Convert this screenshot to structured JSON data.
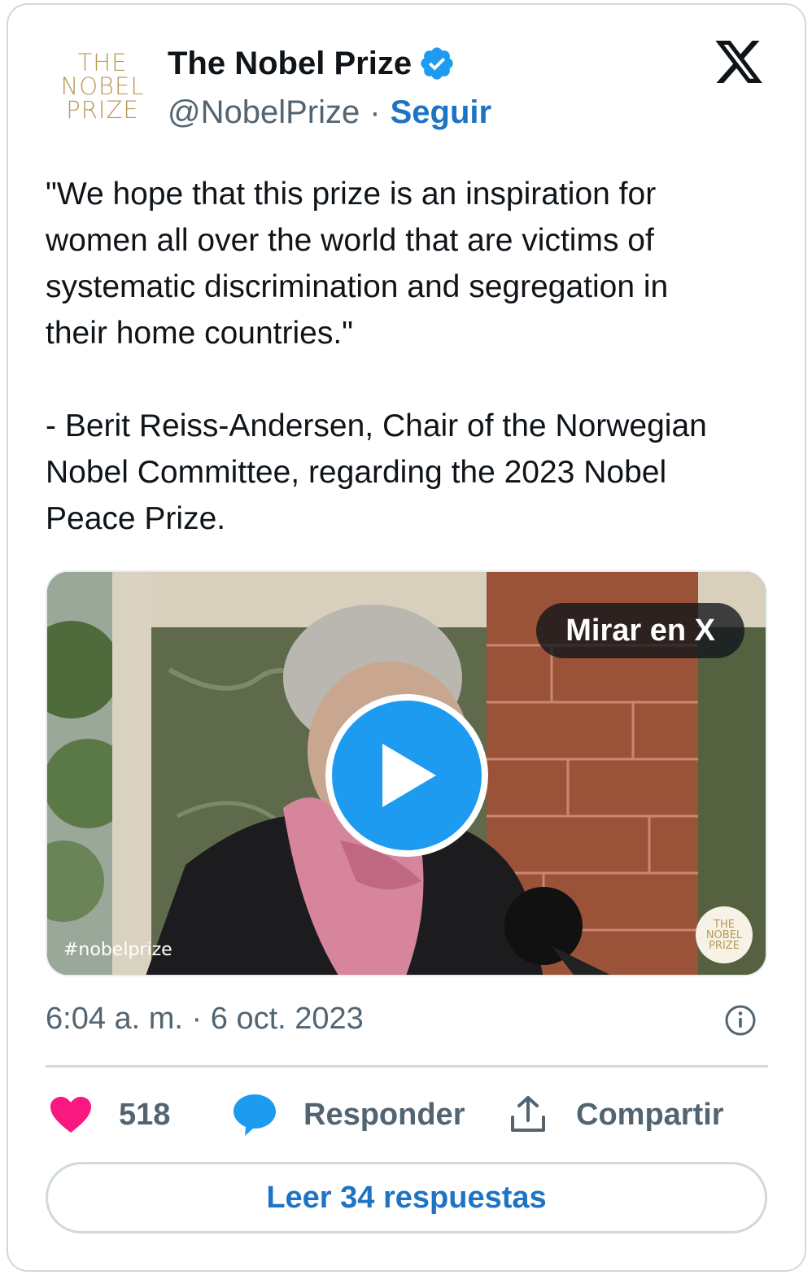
{
  "author": {
    "avatar_lines": [
      "THE",
      "NOBEL",
      "PRIZE"
    ],
    "name": "The Nobel Prize",
    "handle": "@NobelPrize",
    "separator": "·",
    "follow_label": "Seguir"
  },
  "tweet": {
    "text": "\"We hope that this prize is an inspiration for\nwomen all over the world that are victims of\nsystematic discrimination and segregation in\ntheir home countries.\"\n\n- Berit Reiss-Andersen, Chair of the Norwegian\nNobel Committee, regarding the 2023 Nobel\nPeace Prize."
  },
  "media": {
    "watch_label": "Mirar en X",
    "hashtag": "#nobelprize",
    "logo_lines": [
      "THE",
      "NOBEL",
      "PRIZE"
    ]
  },
  "meta": {
    "timestamp": "6:04 a. m. · 6 oct. 2023"
  },
  "actions": {
    "likes": "518",
    "reply_label": "Responder",
    "share_label": "Compartir"
  },
  "read_replies_label": "Leer 34 respuestas",
  "colors": {
    "link_blue": "#1d74c5",
    "play_blue": "#1d9bf0",
    "like_pink": "#f91880",
    "reply_blue": "#1d9bf0",
    "muted": "#536471",
    "border": "#cfd9de"
  }
}
